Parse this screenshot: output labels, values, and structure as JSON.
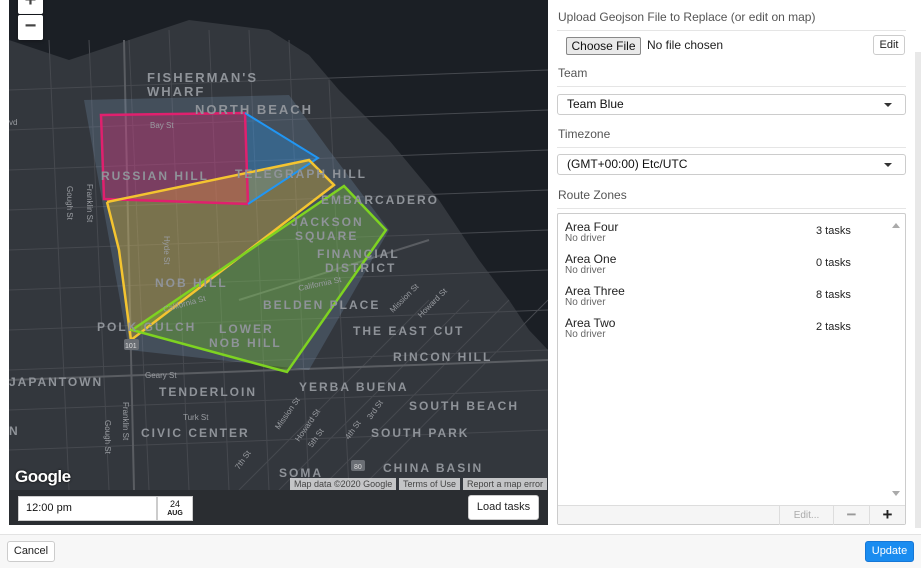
{
  "map": {
    "zoom_in": "+",
    "zoom_out": "−",
    "google_logo": "Google",
    "attribution_data": "Map data ©2020 Google",
    "attribution_terms": "Terms of Use",
    "attribution_report": "Report a map error",
    "labels": {
      "fishermans_wharf_1": "FISHERMAN'S",
      "fishermans_wharf_2": "WHARF",
      "north_beach": "NORTH BEACH",
      "bay_st": "Bay St",
      "russian_hill": "RUSSIAN HILL",
      "telegraph_hill": "TELEGRAPH HILL",
      "embarcadero": "EMBARCADERO",
      "jackson_1": "JACKSON",
      "jackson_2": "SQUARE",
      "financial_1": "FINANCIAL",
      "financial_2": "DISTRICT",
      "nob_hill": "NOB HILL",
      "belden_place": "BELDEN PLACE",
      "polk_gulch": "POLK GULCH",
      "lower_nob_1": "LOWER",
      "lower_nob_2": "NOB HILL",
      "east_cut": "THE EAST CUT",
      "rincon_hill": "RINCON HILL",
      "japantown": "JAPANTOWN",
      "tenderloin": "TENDERLOIN",
      "yerba_buena": "YERBA BUENA",
      "south_beach": "SOUTH BEACH",
      "civic_center": "CIVIC CENTER",
      "south_park": "SOUTH PARK",
      "soma": "SOMA",
      "china_basin": "CHINA BASIN",
      "gough_st": "Gough St",
      "franklin_st": "Franklin St",
      "hyde_st": "Hyde St",
      "california_st_1": "California St",
      "california_st_2": "California St",
      "mission_st_1": "Mission St",
      "mission_st_2": "Mission St",
      "howard_st_1": "Howard St",
      "howard_st_2": "Howard St",
      "geary_st": "Geary St",
      "turk_st": "Turk St",
      "franklin_st_2": "Franklin St",
      "gough_st_2": "Gough St",
      "fifth_st": "5th St",
      "fourth_st": "4th St",
      "third_st": "3rd St",
      "seventh_st": "7th St",
      "left_edge_1": "vd",
      "left_edge_2": "N",
      "highway_101": "101",
      "highway_80": "80"
    },
    "zone_colors": {
      "pink": "#e0206e",
      "blue": "#2196f3",
      "yellow": "#f4c430",
      "green": "#7ed321"
    }
  },
  "map_bar": {
    "time": "12:00 pm",
    "date_day": "24",
    "date_month": "AUG",
    "load_tasks": "Load tasks"
  },
  "panel": {
    "upload_label": "Upload Geojson File to Replace (or edit on map)",
    "choose_file": "Choose File",
    "no_file": "No file chosen",
    "edit": "Edit",
    "team_label": "Team",
    "team_value": "Team Blue",
    "timezone_label": "Timezone",
    "timezone_value": "(GMT+00:00) Etc/UTC",
    "route_zones_label": "Route Zones",
    "zones": [
      {
        "name": "Area Four",
        "driver": "No driver",
        "tasks": "3 tasks"
      },
      {
        "name": "Area One",
        "driver": "No driver",
        "tasks": "0 tasks"
      },
      {
        "name": "Area Three",
        "driver": "No driver",
        "tasks": "8 tasks"
      },
      {
        "name": "Area Two",
        "driver": "No driver",
        "tasks": "2 tasks"
      }
    ],
    "zone_edit": "Edit...",
    "zone_remove": "−",
    "zone_add": "+"
  },
  "footer": {
    "cancel": "Cancel",
    "update": "Update"
  }
}
